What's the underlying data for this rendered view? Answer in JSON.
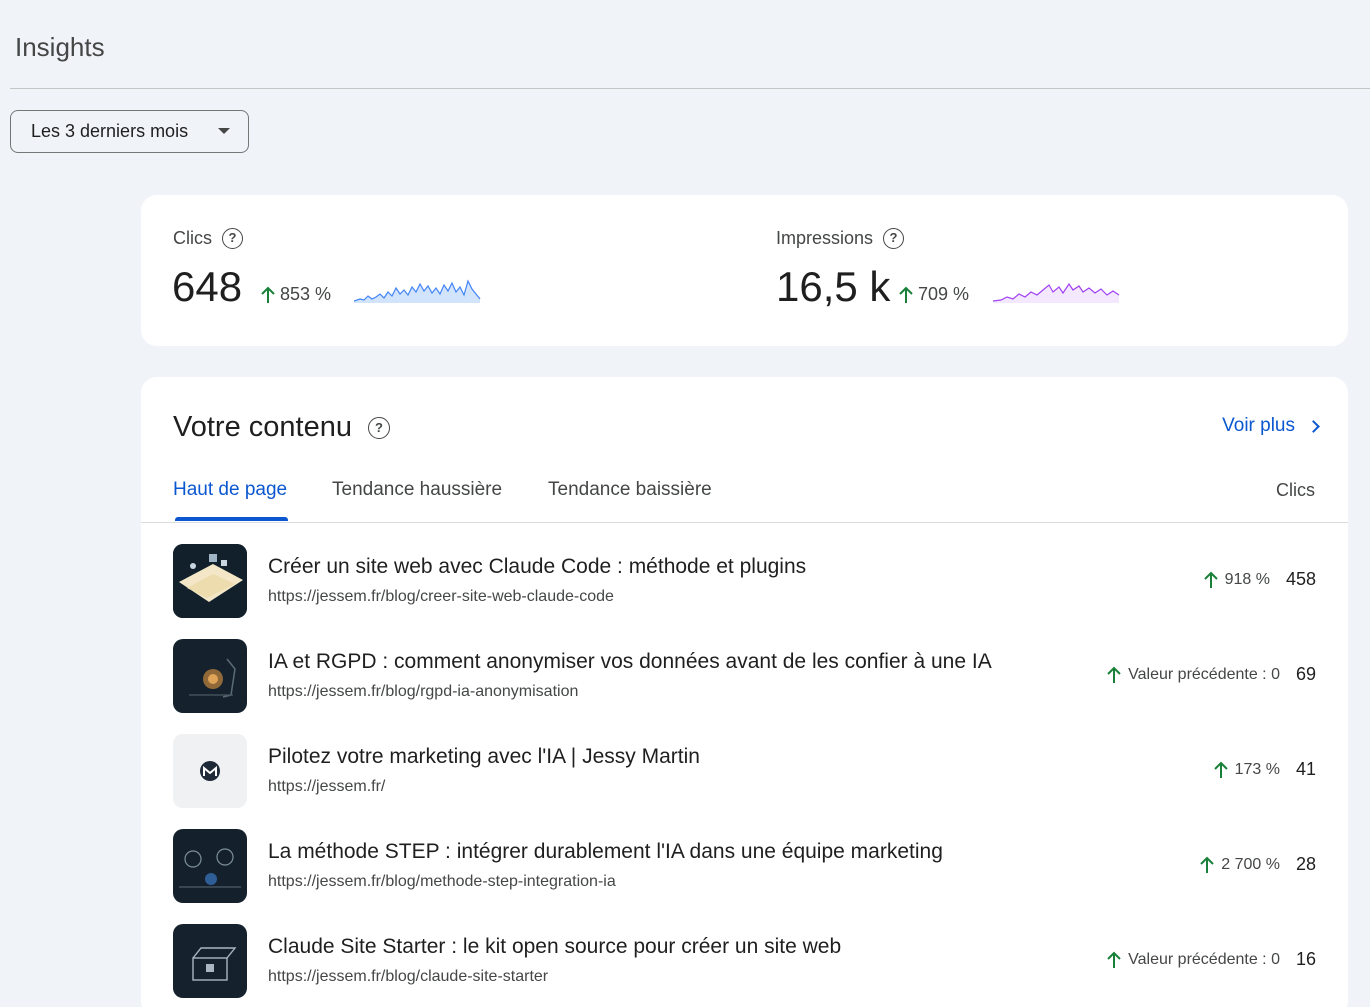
{
  "header": {
    "title": "Insights"
  },
  "filter": {
    "range_label": "Les 3 derniers mois"
  },
  "metrics": {
    "clicks": {
      "label": "Clics",
      "value": "648",
      "delta": "853 %",
      "color": "#4285f4"
    },
    "impressions": {
      "label": "Impressions",
      "value": "16,5 k",
      "delta": "709 %",
      "color": "#a142f4"
    }
  },
  "content": {
    "title": "Votre contenu",
    "see_more": "Voir plus",
    "tabs": [
      {
        "label": "Haut de page",
        "active": true
      },
      {
        "label": "Tendance haussière",
        "active": false
      },
      {
        "label": "Tendance baissière",
        "active": false
      }
    ],
    "column_header": "Clics",
    "rows": [
      {
        "title": "Créer un site web avec Claude Code : méthode et plugins",
        "url": "https://jessem.fr/blog/creer-site-web-claude-code",
        "delta": "918 %",
        "clicks": "458"
      },
      {
        "title": "IA et RGPD : comment anonymiser vos données avant de les confier à une IA",
        "url": "https://jessem.fr/blog/rgpd-ia-anonymisation",
        "delta": "Valeur précédente : 0",
        "clicks": "69"
      },
      {
        "title": "Pilotez votre marketing avec l'IA | Jessy Martin",
        "url": "https://jessem.fr/",
        "delta": "173 %",
        "clicks": "41"
      },
      {
        "title": "La méthode STEP : intégrer durablement l'IA dans une équipe marketing",
        "url": "https://jessem.fr/blog/methode-step-integration-ia",
        "delta": "2 700 %",
        "clicks": "28"
      },
      {
        "title": "Claude Site Starter : le kit open source pour créer un site web",
        "url": "https://jessem.fr/blog/claude-site-starter",
        "delta": "Valeur précédente : 0",
        "clicks": "16"
      }
    ]
  },
  "colors": {
    "accent": "#0b57d0",
    "up": "#188038"
  }
}
